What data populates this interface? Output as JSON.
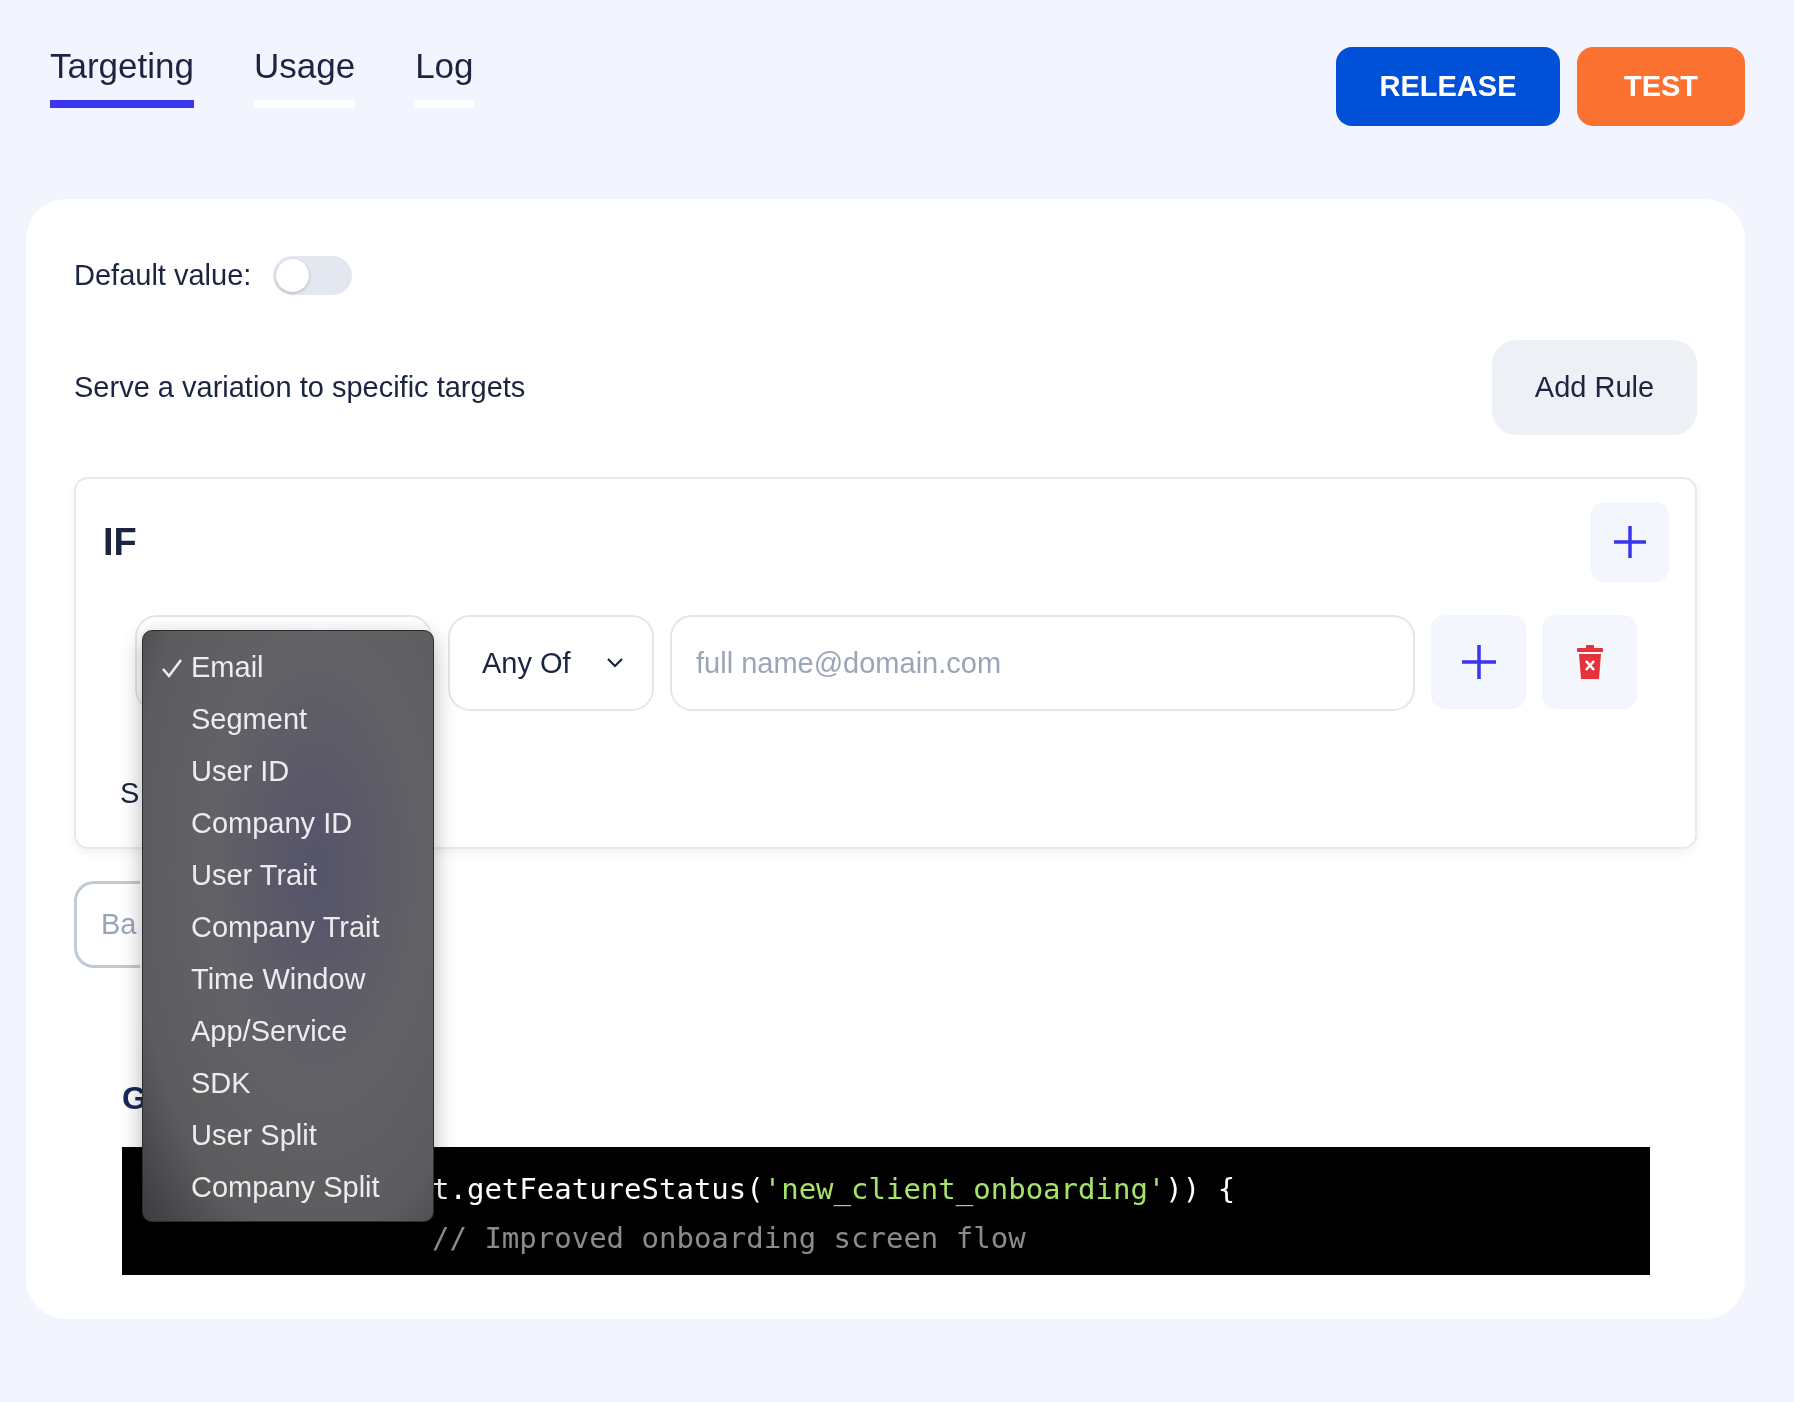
{
  "tabs": [
    {
      "label": "Targeting",
      "selected": true
    },
    {
      "label": "Usage",
      "selected": false
    },
    {
      "label": "Log",
      "selected": false
    }
  ],
  "actions": [
    {
      "label": "RELEASE",
      "kind": "primary"
    },
    {
      "label": "TEST",
      "kind": "accent"
    }
  ],
  "default_value": {
    "label": "Default value:",
    "on": false
  },
  "rules_heading": "Serve a variation to specific targets",
  "add_rule_button": "Add Rule",
  "rule": {
    "title": "IF",
    "operator": "Any Of",
    "placeholder": "full name@domain.com",
    "below_label": "S"
  },
  "partial_button": "Ba",
  "code_section": {
    "heading": "G",
    "lines": [
      [
        {
          "text": "t.getFeatureStatus(",
          "kind": "plain"
        },
        {
          "text": "'new_client_onboarding'",
          "kind": "string"
        },
        {
          "text": ")) {",
          "kind": "plain"
        }
      ],
      [
        {
          "text": "// Improved onboarding screen flow",
          "kind": "comment"
        }
      ]
    ]
  },
  "dropdown": {
    "options": [
      {
        "label": "Email",
        "selected": true
      },
      {
        "label": "Segment",
        "selected": false
      },
      {
        "label": "User ID",
        "selected": false
      },
      {
        "label": "Company ID",
        "selected": false
      },
      {
        "label": "User Trait",
        "selected": false
      },
      {
        "label": "Company Trait",
        "selected": false
      },
      {
        "label": "Time Window",
        "selected": false
      },
      {
        "label": "App/Service",
        "selected": false
      },
      {
        "label": "SDK",
        "selected": false
      },
      {
        "label": "User Split",
        "selected": false
      },
      {
        "label": "Company Split",
        "selected": false
      }
    ]
  }
}
